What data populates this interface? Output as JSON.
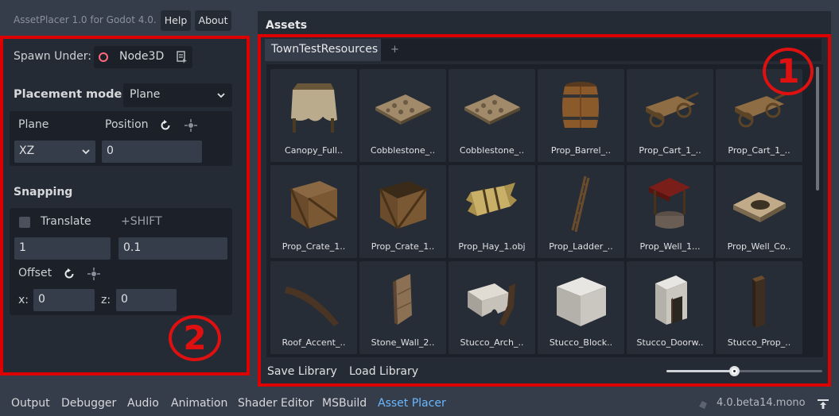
{
  "window": {
    "app_title": "AssetPlacer 1.0 for Godot 4.0.",
    "help_label": "Help",
    "about_label": "About"
  },
  "left_panel": {
    "spawn_under_label": "Spawn Under:",
    "spawn_node": "Node3D",
    "placement_mode_label": "Placement mode:",
    "placement_mode_value": "Plane",
    "plane_label": "Plane",
    "position_label": "Position",
    "plane_axis_value": "XZ",
    "position_value": "0",
    "snapping_label": "Snapping",
    "translate_label": "Translate",
    "shift_hint": "+SHIFT",
    "translate_snap_value": "1",
    "translate_snap_shift_value": "0.1",
    "offset_label": "Offset",
    "x_label": "x:",
    "x_value": "0",
    "z_label": "z:",
    "z_value": "0",
    "translate_checked": false
  },
  "assets_panel": {
    "title": "Assets",
    "tabs": [
      {
        "label": "TownTestResources"
      }
    ],
    "add_tab_label": "+",
    "items": [
      {
        "label": "Canopy_Full..",
        "icon": "canopy"
      },
      {
        "label": "Cobblestone_..",
        "icon": "cobblestone"
      },
      {
        "label": "Cobblestone_..",
        "icon": "cobblestone"
      },
      {
        "label": "Prop_Barrel_..",
        "icon": "barrel"
      },
      {
        "label": "Prop_Cart_1_..",
        "icon": "cart"
      },
      {
        "label": "Prop_Cart_1_..",
        "icon": "cart"
      },
      {
        "label": "Prop_Crate_1..",
        "icon": "crate"
      },
      {
        "label": "Prop_Crate_1..",
        "icon": "crate-open"
      },
      {
        "label": "Prop_Hay_1.obj",
        "icon": "hay"
      },
      {
        "label": "Prop_Ladder_..",
        "icon": "ladder"
      },
      {
        "label": "Prop_Well_1...",
        "icon": "well"
      },
      {
        "label": "Prop_Well_Co..",
        "icon": "well-cover"
      },
      {
        "label": "Roof_Accent_..",
        "icon": "roof-accent"
      },
      {
        "label": "Stone_Wall_2..",
        "icon": "stone-wall"
      },
      {
        "label": "Stucco_Arch_..",
        "icon": "stucco-arch"
      },
      {
        "label": "Stucco_Block..",
        "icon": "stucco-block"
      },
      {
        "label": "Stucco_Doorw..",
        "icon": "stucco-doorway"
      },
      {
        "label": "Stucco_Prop_..",
        "icon": "stucco-prop"
      }
    ],
    "save_library_label": "Save Library",
    "load_library_label": "Load Library",
    "thumbnail_size_fraction": 0.44
  },
  "annotations": {
    "one": "1",
    "two": "2"
  },
  "bottom_bar": {
    "tabs": [
      {
        "label": "Output"
      },
      {
        "label": "Debugger"
      },
      {
        "label": "Audio"
      },
      {
        "label": "Animation"
      },
      {
        "label": "Shader Editor"
      },
      {
        "label": "MSBuild"
      },
      {
        "label": "Asset Placer"
      }
    ],
    "active_tab": "Asset Placer",
    "version": "4.0.beta14.mono"
  },
  "colors": {
    "accent_blue": "#6ab8ff",
    "annotation_red": "#dd0000",
    "node_icon_red": "#ff6b7a"
  }
}
